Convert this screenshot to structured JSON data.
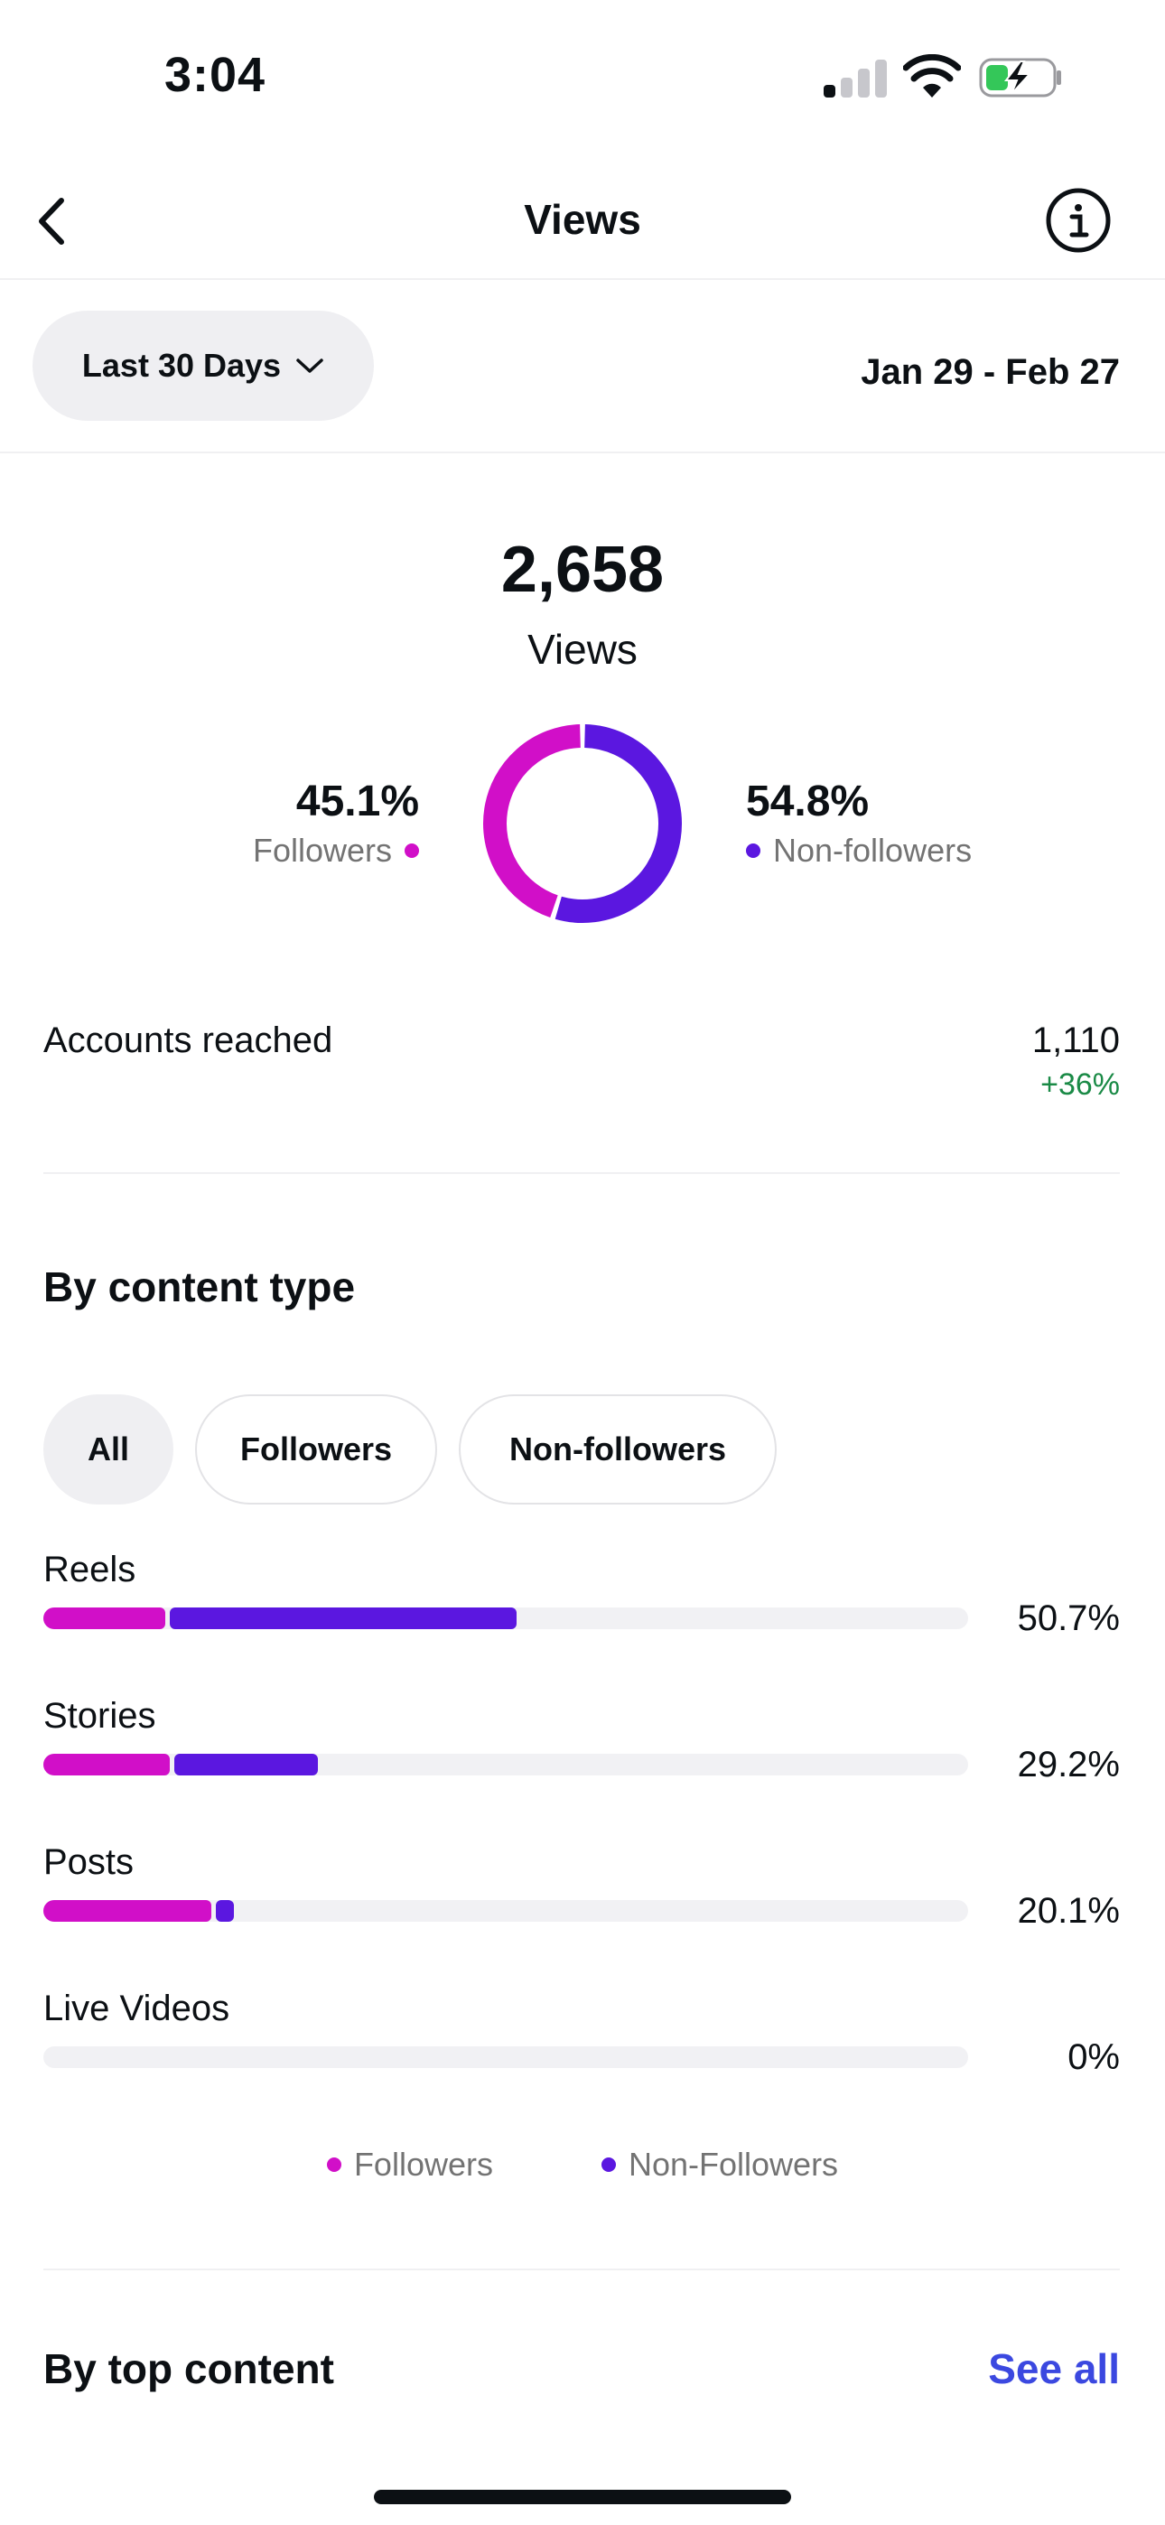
{
  "status_bar": {
    "time": "3:04"
  },
  "nav": {
    "title": "Views"
  },
  "filter": {
    "range_label": "Last 30 Days",
    "date_range": "Jan 29 - Feb 27"
  },
  "summary": {
    "total": "2,658",
    "total_label": "Views",
    "followers_pct": "45.1%",
    "followers_label": "Followers",
    "nonfollowers_pct": "54.8%",
    "nonfollowers_label": "Non-followers",
    "donut": {
      "followers": 45.1,
      "nonfollowers": 54.8
    }
  },
  "reach": {
    "label": "Accounts reached",
    "value": "1,110",
    "change": "+36%"
  },
  "content_type": {
    "title": "By content type",
    "chips": [
      "All",
      "Followers",
      "Non-followers"
    ],
    "active_chip": "All",
    "rows": [
      {
        "label": "Reels",
        "pct": "50.7%",
        "followers": 13.2,
        "nonfollowers": 37.5
      },
      {
        "label": "Stories",
        "pct": "29.2%",
        "followers": 13.7,
        "nonfollowers": 15.5
      },
      {
        "label": "Posts",
        "pct": "20.1%",
        "followers": 18.2,
        "nonfollowers": 1.9
      },
      {
        "label": "Live Videos",
        "pct": "0%",
        "followers": 0,
        "nonfollowers": 0
      }
    ],
    "legend": {
      "followers": "Followers",
      "nonfollowers": "Non-Followers"
    }
  },
  "top_content": {
    "title": "By top content",
    "see_all": "See all"
  },
  "colors": {
    "followers": "#d10fc8",
    "nonfollowers": "#5b17e0",
    "positive": "#1a8a46",
    "link": "#3b48e0"
  }
}
